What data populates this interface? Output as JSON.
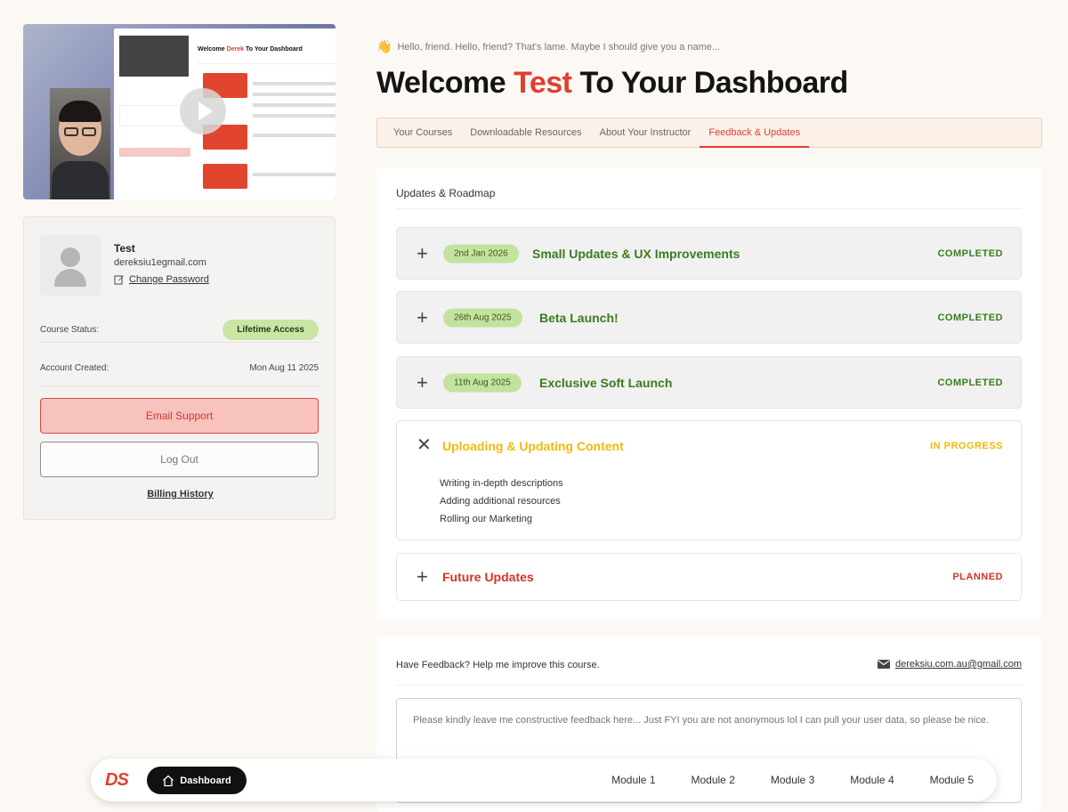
{
  "video": {
    "mini_title_pre": "Welcome ",
    "mini_title_name": "Derek",
    "mini_title_post": " To Your Dashboard"
  },
  "profile": {
    "name": "Test",
    "email": "dereksiu1egmail.com",
    "change_password": "Change Password",
    "course_status_label": "Course Status:",
    "course_status_value": "Lifetime Access",
    "account_created_label": "Account Created:",
    "account_created_value": "Mon Aug 11 2025",
    "email_support": "Email Support",
    "logout": "Log Out",
    "billing_history": "Billing History"
  },
  "header": {
    "greeting": "Hello, friend. Hello, friend? That's lame. Maybe I should give you a name...",
    "title_pre": "Welcome ",
    "title_name": "Test",
    "title_post": " To Your Dashboard"
  },
  "tabs": [
    {
      "label": "Your Courses"
    },
    {
      "label": "Downloadable Resources"
    },
    {
      "label": "About Your Instructor"
    },
    {
      "label": "Feedback & Updates",
      "active": true
    }
  ],
  "roadmap": {
    "heading": "Updates & Roadmap",
    "items": [
      {
        "date": "2nd Jan 2026",
        "title": "Small Updates & UX Improvements",
        "status": "COMPLETED"
      },
      {
        "date": "26th Aug 2025",
        "title": "Beta Launch!",
        "status": "COMPLETED"
      },
      {
        "date": "11th Aug 2025",
        "title": "Exclusive Soft Launch",
        "status": "COMPLETED"
      }
    ],
    "in_progress": {
      "title": "Uploading & Updating Content",
      "status": "IN PROGRESS",
      "tasks": [
        "Writing in-depth descriptions",
        "Adding additional resources",
        "Rolling our Marketing"
      ]
    },
    "planned": {
      "title": "Future Updates",
      "status": "PLANNED"
    }
  },
  "feedback": {
    "heading": "Have Feedback? Help me improve this course.",
    "email": "dereksiu.com.au@gmail.com",
    "placeholder": "Please kindly leave me constructive feedback here... Just FYI you are not anonymous lol I can pull your user data, so please be nice."
  },
  "nav": {
    "logo": "DS",
    "dashboard": "Dashboard",
    "modules": [
      "Module 1",
      "Module 2",
      "Module 3",
      "Module 4",
      "Module 5"
    ]
  },
  "colors": {
    "accent": "#e0402f",
    "completed": "#3b7b1e",
    "in_progress": "#f0b90a",
    "planned": "#d6342a",
    "badge_green": "#c4e29f",
    "background": "#fcf9f5"
  }
}
